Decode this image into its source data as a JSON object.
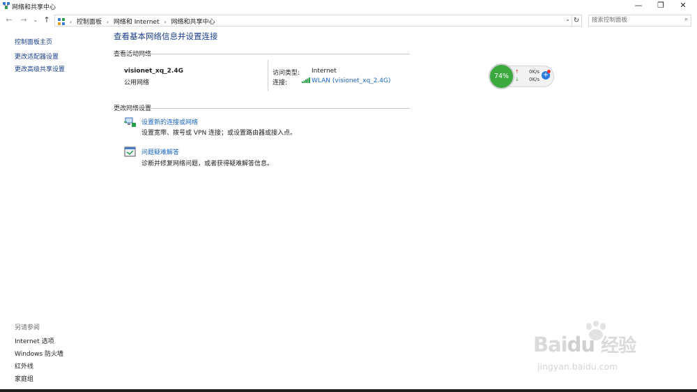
{
  "window": {
    "title": "网络和共享中心",
    "minimize": "—",
    "maximize": "❐",
    "close": "✕"
  },
  "nav": {
    "back": "←",
    "forward": "→",
    "recent": "⌄",
    "up": "↑",
    "refresh": "↻",
    "dropdown": "⌄"
  },
  "breadcrumb": [
    "控制面板",
    "网络和 Internet",
    "网络和共享中心"
  ],
  "search": {
    "placeholder": "搜索控制面板"
  },
  "sidebar": {
    "items": [
      {
        "label": "控制面板主页"
      },
      {
        "label": "更改适配器设置"
      },
      {
        "label": "更改高级共享设置"
      }
    ]
  },
  "see_also": {
    "header": "另请参阅",
    "items": [
      {
        "label": "Internet 选项"
      },
      {
        "label": "Windows 防火墙"
      },
      {
        "label": "红外线"
      },
      {
        "label": "家庭组"
      }
    ]
  },
  "main": {
    "title": "查看基本网络信息并设置连接",
    "active_header": "查看活动网络",
    "network": {
      "name": "visionet_xq_2.4G",
      "category": "公用网络",
      "access_label": "访问类型:",
      "access_value": "Internet",
      "conn_label": "连接:",
      "conn_value": "WLAN (visionet_xq_2.4G)"
    },
    "change_header": "更改网络设置",
    "tasks": [
      {
        "link": "设置新的连接或网络",
        "desc": "设置宽带、拨号或 VPN 连接；或设置路由器或接入点。"
      },
      {
        "link": "问题疑难解答",
        "desc": "诊断并修复网络问题，或者获得疑难解答信息。"
      }
    ]
  },
  "widget": {
    "percent": "74%",
    "up_speed": "0K/s",
    "down_speed": "0K/s",
    "plus": "+"
  },
  "watermark": {
    "text_latin": "Bai",
    "text_du": "du",
    "text_cn": "经验",
    "url": "jingyan.baidu.com"
  },
  "colors": {
    "link": "#1a66c2",
    "title": "#1a3e8c",
    "gauge": "#3ca93f"
  }
}
